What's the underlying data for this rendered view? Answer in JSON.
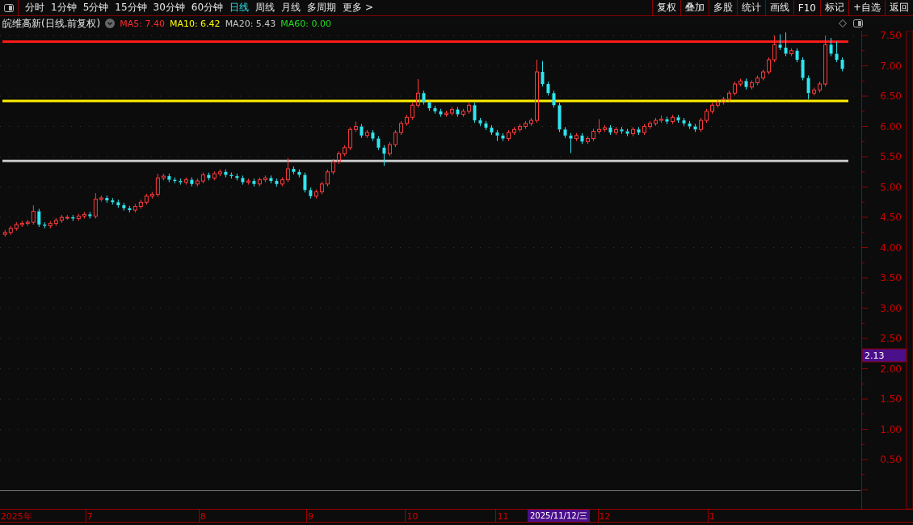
{
  "toolbar": {
    "tabs": [
      {
        "label": "分时",
        "selected": false
      },
      {
        "label": "1分钟",
        "selected": false
      },
      {
        "label": "5分钟",
        "selected": false
      },
      {
        "label": "15分钟",
        "selected": false
      },
      {
        "label": "30分钟",
        "selected": false
      },
      {
        "label": "60分钟",
        "selected": false
      },
      {
        "label": "日线",
        "selected": true
      },
      {
        "label": "周线",
        "selected": false
      },
      {
        "label": "月线",
        "selected": false
      },
      {
        "label": "多周期",
        "selected": false
      }
    ],
    "more": "更多 >",
    "buttons": [
      "复权",
      "叠加",
      "多股",
      "统计",
      "画线",
      "F10",
      "标记",
      "+自选",
      "返回"
    ]
  },
  "info": {
    "title": "皖维高新(日线.前复权)",
    "indicators": [
      {
        "label": "MA5: 7.40",
        "color": "#ff2a2a"
      },
      {
        "label": "MA10: 6.42",
        "color": "#ffff00"
      },
      {
        "label": "MA20: 5.43",
        "color": "#c8c8c8"
      },
      {
        "label": "MA60: 0.00",
        "color": "#22dd22"
      }
    ]
  },
  "chart": {
    "chart_data": {
      "type": "candlestick",
      "ylim": [
        -0.31,
        7.58
      ],
      "grid": true,
      "ref_lines": [
        {
          "axis": "y",
          "value": 7.4,
          "color": "#ff1a1a"
        },
        {
          "axis": "y",
          "value": 6.42,
          "color": "#ffee00"
        },
        {
          "axis": "y",
          "value": 5.43,
          "color": "#c8c8c8"
        }
      ],
      "yticks": [
        {
          "value": 7.5,
          "label": "7.50"
        },
        {
          "value": 7,
          "label": "7.00"
        },
        {
          "value": 6.5,
          "label": "6.50"
        },
        {
          "value": 6,
          "label": "6.00"
        },
        {
          "value": 5.5,
          "label": "5.50"
        },
        {
          "value": 5,
          "label": "5.00"
        },
        {
          "value": 4.5,
          "label": "4.50"
        },
        {
          "value": 4,
          "label": "4.00"
        },
        {
          "value": 3.5,
          "label": "3.50"
        },
        {
          "value": 3,
          "label": "3.00"
        },
        {
          "value": 2.5,
          "label": "2.50"
        },
        {
          "value": 2,
          "label": "2.00"
        },
        {
          "value": 1.5,
          "label": "1.50"
        },
        {
          "value": 1,
          "label": "1.00"
        },
        {
          "value": 0.5,
          "label": "0.50"
        }
      ],
      "categories": [
        null,
        null,
        "2025年",
        null,
        null,
        null,
        null,
        null,
        null,
        null,
        null,
        null,
        null,
        null,
        null,
        "7",
        null,
        null,
        null,
        null,
        null,
        null,
        null,
        null,
        null,
        null,
        null,
        null,
        null,
        null,
        null,
        null,
        null,
        null,
        null,
        "8",
        null,
        null,
        null,
        null,
        null,
        null,
        null,
        null,
        null,
        null,
        null,
        null,
        null,
        null,
        null,
        null,
        null,
        null,
        "9",
        null,
        null,
        null,
        null,
        null,
        null,
        null,
        null,
        null,
        null,
        null,
        null,
        null,
        null,
        null,
        null,
        null,
        "10",
        null,
        null,
        null,
        null,
        null,
        null,
        null,
        null,
        null,
        null,
        null,
        null,
        null,
        null,
        null,
        "11",
        null,
        null,
        null,
        null,
        null,
        null,
        null,
        null,
        null,
        null,
        null,
        null,
        null,
        null,
        null,
        null,
        null,
        "12",
        null,
        null,
        null,
        null,
        null,
        null,
        null,
        null,
        null,
        null,
        null,
        null,
        null,
        null,
        null,
        null,
        null,
        null,
        "1",
        null,
        null,
        null,
        null,
        null,
        null,
        null,
        null,
        null,
        null,
        null,
        null,
        null,
        null,
        null,
        null,
        null,
        null,
        null,
        null,
        null,
        null,
        null
      ],
      "ohlc": [
        [
          4.22,
          4.29,
          4.18,
          4.25
        ],
        [
          4.25,
          4.36,
          4.21,
          4.32
        ],
        [
          4.32,
          4.42,
          4.28,
          4.38
        ],
        [
          4.38,
          4.44,
          4.34,
          4.4
        ],
        [
          4.4,
          4.46,
          4.36,
          4.42
        ],
        [
          4.42,
          4.7,
          4.38,
          4.6
        ],
        [
          4.6,
          4.64,
          4.34,
          4.38
        ],
        [
          4.38,
          4.42,
          4.32,
          4.36
        ],
        [
          4.36,
          4.44,
          4.32,
          4.4
        ],
        [
          4.4,
          4.49,
          4.36,
          4.45
        ],
        [
          4.45,
          4.54,
          4.41,
          4.5
        ],
        [
          4.5,
          4.54,
          4.46,
          4.5
        ],
        [
          4.5,
          4.54,
          4.44,
          4.48
        ],
        [
          4.48,
          4.56,
          4.44,
          4.52
        ],
        [
          4.52,
          4.59,
          4.48,
          4.55
        ],
        [
          4.55,
          4.59,
          4.48,
          4.52
        ],
        [
          4.52,
          4.9,
          4.48,
          4.8
        ],
        [
          4.8,
          4.86,
          4.76,
          4.82
        ],
        [
          4.82,
          4.86,
          4.74,
          4.78
        ],
        [
          4.78,
          4.82,
          4.71,
          4.75
        ],
        [
          4.75,
          4.79,
          4.66,
          4.7
        ],
        [
          4.7,
          4.74,
          4.61,
          4.65
        ],
        [
          4.65,
          4.69,
          4.58,
          4.62
        ],
        [
          4.62,
          4.72,
          4.58,
          4.68
        ],
        [
          4.68,
          4.79,
          4.64,
          4.75
        ],
        [
          4.75,
          4.89,
          4.71,
          4.85
        ],
        [
          4.85,
          4.92,
          4.81,
          4.88
        ],
        [
          4.88,
          5.22,
          4.84,
          5.15
        ],
        [
          5.15,
          5.22,
          5.11,
          5.18
        ],
        [
          5.18,
          5.22,
          5.08,
          5.12
        ],
        [
          5.12,
          5.16,
          5.06,
          5.1
        ],
        [
          5.1,
          5.14,
          5.04,
          5.08
        ],
        [
          5.08,
          5.16,
          5.04,
          5.12
        ],
        [
          5.12,
          5.16,
          5.01,
          5.05
        ],
        [
          5.05,
          5.14,
          5.01,
          5.1
        ],
        [
          5.1,
          5.24,
          5.06,
          5.2
        ],
        [
          5.2,
          5.24,
          5.11,
          5.15
        ],
        [
          5.15,
          5.26,
          5.11,
          5.22
        ],
        [
          5.22,
          5.29,
          5.18,
          5.25
        ],
        [
          5.25,
          5.29,
          5.16,
          5.2
        ],
        [
          5.2,
          5.24,
          5.14,
          5.18
        ],
        [
          5.18,
          5.22,
          5.11,
          5.15
        ],
        [
          5.15,
          5.19,
          5.04,
          5.08
        ],
        [
          5.08,
          5.14,
          5.04,
          5.1
        ],
        [
          5.1,
          5.14,
          5.01,
          5.05
        ],
        [
          5.05,
          5.16,
          5.01,
          5.12
        ],
        [
          5.12,
          5.19,
          5.08,
          5.15
        ],
        [
          5.15,
          5.19,
          5.06,
          5.1
        ],
        [
          5.1,
          5.14,
          5.01,
          5.05
        ],
        [
          5.05,
          5.16,
          5.01,
          5.12
        ],
        [
          5.12,
          5.48,
          5.08,
          5.3
        ],
        [
          5.3,
          5.34,
          5.21,
          5.25
        ],
        [
          5.25,
          5.29,
          5.16,
          5.2
        ],
        [
          5.2,
          5.24,
          4.91,
          4.95
        ],
        [
          4.95,
          4.99,
          4.81,
          4.85
        ],
        [
          4.85,
          4.96,
          4.81,
          4.92
        ],
        [
          4.92,
          5.09,
          4.88,
          5.05
        ],
        [
          5.05,
          5.29,
          5.01,
          5.25
        ],
        [
          5.25,
          5.46,
          5.21,
          5.42
        ],
        [
          5.42,
          5.59,
          5.38,
          5.55
        ],
        [
          5.55,
          5.69,
          5.51,
          5.65
        ],
        [
          5.65,
          5.99,
          5.61,
          5.95
        ],
        [
          5.95,
          6.08,
          5.91,
          6.0
        ],
        [
          6.0,
          6.04,
          5.81,
          5.85
        ],
        [
          5.85,
          5.94,
          5.81,
          5.9
        ],
        [
          5.9,
          5.94,
          5.76,
          5.8
        ],
        [
          5.8,
          5.84,
          5.61,
          5.65
        ],
        [
          5.65,
          5.69,
          5.35,
          5.55
        ],
        [
          5.55,
          5.74,
          5.51,
          5.7
        ],
        [
          5.7,
          5.94,
          5.66,
          5.9
        ],
        [
          5.9,
          6.09,
          5.86,
          6.05
        ],
        [
          6.05,
          6.19,
          6.01,
          6.15
        ],
        [
          6.15,
          6.39,
          6.11,
          6.35
        ],
        [
          6.35,
          6.78,
          6.31,
          6.55
        ],
        [
          6.55,
          6.59,
          6.36,
          6.4
        ],
        [
          6.4,
          6.44,
          6.26,
          6.3
        ],
        [
          6.3,
          6.34,
          6.21,
          6.25
        ],
        [
          6.25,
          6.29,
          6.16,
          6.2
        ],
        [
          6.2,
          6.26,
          6.16,
          6.22
        ],
        [
          6.22,
          6.32,
          6.18,
          6.28
        ],
        [
          6.28,
          6.32,
          6.16,
          6.2
        ],
        [
          6.2,
          6.29,
          6.16,
          6.25
        ],
        [
          6.25,
          6.39,
          6.21,
          6.35
        ],
        [
          6.35,
          6.39,
          6.06,
          6.1
        ],
        [
          6.1,
          6.14,
          6.01,
          6.05
        ],
        [
          6.05,
          6.09,
          5.94,
          5.98
        ],
        [
          5.98,
          6.02,
          5.86,
          5.9
        ],
        [
          5.9,
          5.94,
          5.76,
          5.85
        ],
        [
          5.85,
          5.89,
          5.76,
          5.8
        ],
        [
          5.8,
          5.94,
          5.76,
          5.9
        ],
        [
          5.9,
          5.99,
          5.86,
          5.95
        ],
        [
          5.95,
          6.04,
          5.91,
          6.0
        ],
        [
          6.0,
          6.09,
          5.96,
          6.05
        ],
        [
          6.05,
          6.14,
          6.01,
          6.1
        ],
        [
          6.1,
          7.1,
          6.06,
          6.9
        ],
        [
          6.9,
          7.08,
          6.66,
          6.7
        ],
        [
          6.7,
          6.74,
          6.51,
          6.55
        ],
        [
          6.55,
          6.59,
          6.31,
          6.35
        ],
        [
          6.35,
          6.39,
          5.91,
          5.95
        ],
        [
          5.95,
          5.99,
          5.81,
          5.85
        ],
        [
          5.85,
          5.89,
          5.56,
          5.8
        ],
        [
          5.8,
          5.89,
          5.76,
          5.85
        ],
        [
          5.85,
          5.89,
          5.71,
          5.75
        ],
        [
          5.75,
          5.84,
          5.71,
          5.8
        ],
        [
          5.8,
          5.96,
          5.76,
          5.92
        ],
        [
          5.92,
          6.12,
          5.88,
          5.95
        ],
        [
          5.95,
          6.02,
          5.91,
          5.98
        ],
        [
          5.98,
          6.02,
          5.86,
          5.9
        ],
        [
          5.9,
          5.99,
          5.86,
          5.95
        ],
        [
          5.95,
          5.99,
          5.88,
          5.92
        ],
        [
          5.92,
          5.96,
          5.84,
          5.88
        ],
        [
          5.88,
          5.99,
          5.84,
          5.95
        ],
        [
          5.95,
          5.99,
          5.86,
          5.9
        ],
        [
          5.9,
          6.04,
          5.86,
          6.0
        ],
        [
          6.0,
          6.09,
          5.96,
          6.05
        ],
        [
          6.05,
          6.14,
          6.01,
          6.1
        ],
        [
          6.1,
          6.18,
          6.06,
          6.12
        ],
        [
          6.12,
          6.16,
          6.04,
          6.08
        ],
        [
          6.08,
          6.19,
          6.04,
          6.15
        ],
        [
          6.15,
          6.19,
          6.06,
          6.1
        ],
        [
          6.1,
          6.14,
          6.01,
          6.05
        ],
        [
          6.05,
          6.09,
          5.96,
          6.0
        ],
        [
          6.0,
          6.04,
          5.91,
          5.95
        ],
        [
          5.95,
          6.14,
          5.91,
          6.1
        ],
        [
          6.1,
          6.29,
          6.06,
          6.25
        ],
        [
          6.25,
          6.39,
          6.21,
          6.35
        ],
        [
          6.35,
          6.44,
          6.31,
          6.4
        ],
        [
          6.4,
          6.49,
          6.36,
          6.45
        ],
        [
          6.45,
          6.59,
          6.41,
          6.55
        ],
        [
          6.55,
          6.74,
          6.51,
          6.7
        ],
        [
          6.7,
          6.79,
          6.66,
          6.75
        ],
        [
          6.75,
          6.79,
          6.61,
          6.65
        ],
        [
          6.65,
          6.76,
          6.61,
          6.72
        ],
        [
          6.72,
          6.84,
          6.68,
          6.8
        ],
        [
          6.8,
          6.94,
          6.76,
          6.9
        ],
        [
          6.9,
          7.14,
          6.86,
          7.1
        ],
        [
          7.1,
          7.5,
          7.06,
          7.35
        ],
        [
          7.35,
          7.52,
          7.26,
          7.3
        ],
        [
          7.3,
          7.55,
          7.16,
          7.2
        ],
        [
          7.2,
          7.29,
          7.16,
          7.25
        ],
        [
          7.25,
          7.29,
          7.06,
          7.1
        ],
        [
          7.1,
          7.14,
          6.76,
          6.8
        ],
        [
          6.8,
          6.84,
          6.45,
          6.55
        ],
        [
          6.55,
          6.64,
          6.51,
          6.6
        ],
        [
          6.6,
          6.74,
          6.56,
          6.7
        ],
        [
          6.7,
          7.5,
          6.66,
          7.35
        ],
        [
          7.35,
          7.46,
          7.16,
          7.2
        ],
        [
          7.2,
          7.4,
          7.06,
          7.1
        ],
        [
          7.1,
          7.14,
          6.91,
          6.95
        ]
      ]
    },
    "cursor_value": "2.13"
  },
  "x_axis": {
    "cursor_date": "2025/11/12/三"
  }
}
